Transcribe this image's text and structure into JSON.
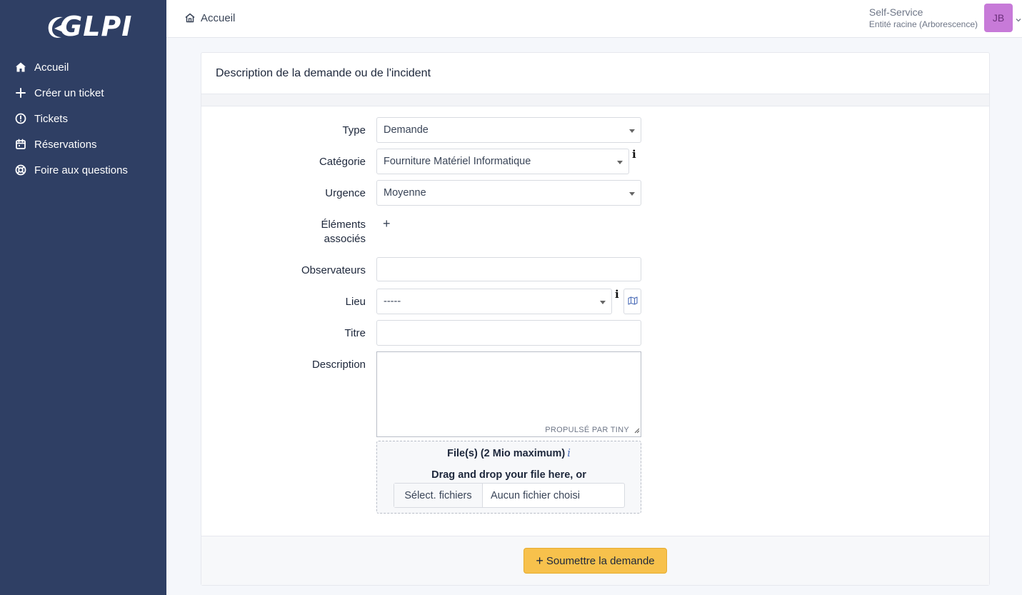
{
  "app": {
    "logo_text": "GLPI"
  },
  "sidebar": {
    "items": [
      {
        "label": "Accueil",
        "icon": "home-icon"
      },
      {
        "label": "Créer un ticket",
        "icon": "plus-icon"
      },
      {
        "label": "Tickets",
        "icon": "alert-circle-icon"
      },
      {
        "label": "Réservations",
        "icon": "calendar-icon"
      },
      {
        "label": "Foire aux questions",
        "icon": "lifebuoy-icon"
      }
    ]
  },
  "header": {
    "breadcrumb": "Accueil",
    "profile": "Self-Service",
    "entity": "Entité racine (Arborescence)",
    "avatar_initials": "JB",
    "avatar_color": "#c77ad8"
  },
  "form": {
    "title": "Description de la demande ou de l'incident",
    "type": {
      "label": "Type",
      "value": "Demande"
    },
    "category": {
      "label": "Catégorie",
      "value": "Fourniture Matériel Informatique",
      "info": "i"
    },
    "urgency": {
      "label": "Urgence",
      "value": "Moyenne"
    },
    "associated": {
      "label_line1": "Éléments",
      "label_line2": "associés",
      "add": "+"
    },
    "observers": {
      "label": "Observateurs",
      "value": ""
    },
    "location": {
      "label": "Lieu",
      "value": "-----",
      "info": "i"
    },
    "title_field": {
      "label": "Titre",
      "value": ""
    },
    "description": {
      "label": "Description",
      "value": "",
      "editor_brand": "PROPULSÉ PAR TINY"
    },
    "files": {
      "title": "File(s) (2 Mio maximum)",
      "info": "i",
      "drag_text": "Drag and drop your file here, or",
      "select_button": "Sélect. fichiers",
      "status": "Aucun fichier choisi"
    },
    "submit": {
      "plus": "+",
      "label": "Soumettre la demande",
      "color": "#f7c14c"
    }
  }
}
